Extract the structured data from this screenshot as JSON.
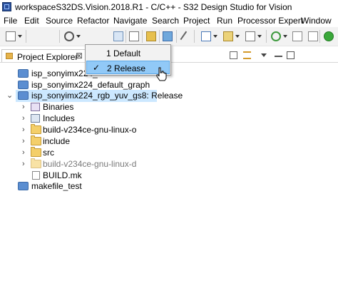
{
  "window": {
    "title": "workspaceS32DS.Vision.2018.R1 - C/C++ - S32 Design Studio for Vision"
  },
  "menubar": {
    "items": [
      "File",
      "Edit",
      "Source",
      "Refactor",
      "Navigate",
      "Search",
      "Project",
      "Run",
      "Processor Expert",
      "Window"
    ]
  },
  "toolbar": {
    "icons": [
      "new-icon",
      "gear-icon",
      "hammer-build-icon",
      "binary-icon",
      "open-type-icon",
      "new-class-icon",
      "new-folder-icon",
      "pin-icon",
      "new-source-icon",
      "debug-config-icon",
      "new-project-icon",
      "refresh-icon",
      "run-icon"
    ]
  },
  "view": {
    "tab_label": "Project Explorer",
    "close_glyph": "⊠"
  },
  "dropdown": {
    "items": [
      {
        "label": "1 Default",
        "selected": false
      },
      {
        "label": "2 Release",
        "selected": true
      }
    ],
    "check_glyph": "✓"
  },
  "tree": {
    "items": [
      {
        "label": "isp_sonyimx224_",
        "icon": "project-folder-icon"
      },
      {
        "label": "isp_sonyimx224_default_graph",
        "icon": "project-folder-icon"
      },
      {
        "label": "isp_sonyimx224_rgb_yuv_gs8: Release",
        "icon": "open-project-icon",
        "expanded": true,
        "selected": true
      },
      {
        "label": "Binaries",
        "icon": "binaries-icon"
      },
      {
        "label": "Includes",
        "icon": "includes-icon"
      },
      {
        "label": "build-v234ce-gnu-linux-o",
        "icon": "folder-icon"
      },
      {
        "label": "include",
        "icon": "folder-icon"
      },
      {
        "label": "src",
        "icon": "source-folder-icon"
      },
      {
        "label": "build-v234ce-gnu-linux-d",
        "icon": "excluded-folder-icon",
        "dimmed": true
      },
      {
        "label": "BUILD.mk",
        "icon": "file-icon"
      },
      {
        "label": "makefile_test",
        "icon": "project-folder-icon"
      }
    ]
  }
}
